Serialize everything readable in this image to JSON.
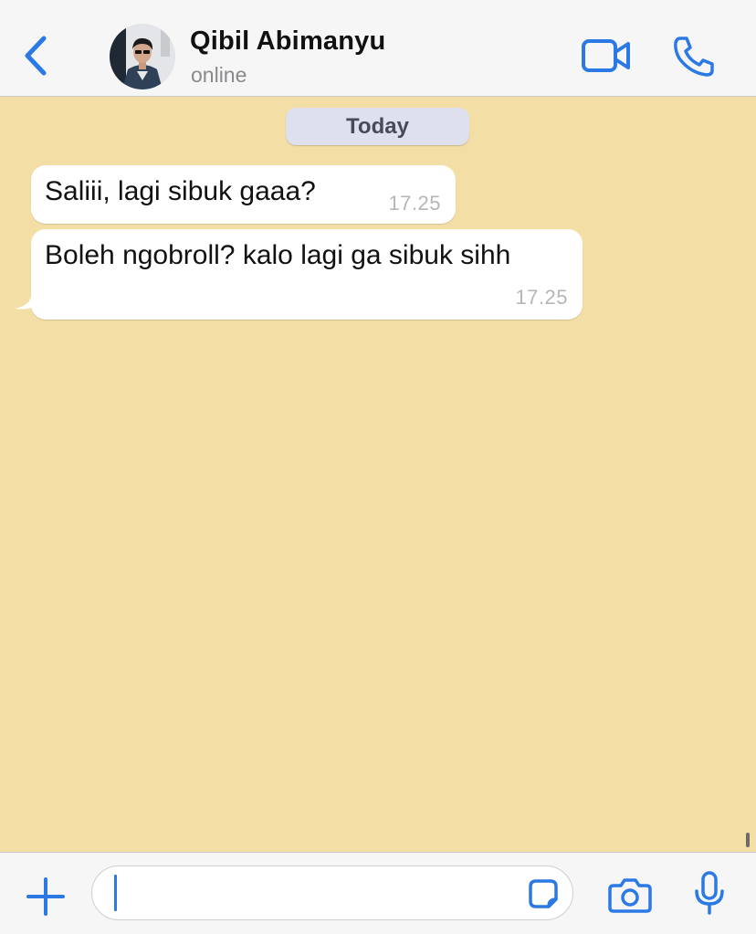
{
  "header": {
    "contact_name": "Qibil Abimanyu",
    "status": "online",
    "icons": [
      "chevron-left-icon",
      "video-camera-icon",
      "phone-icon"
    ]
  },
  "chat": {
    "date_label": "Today",
    "messages": [
      {
        "text": "Saliii, lagi sibuk gaaa?",
        "time": "17.25",
        "direction": "incoming"
      },
      {
        "text": "Boleh ngobroll? kalo lagi ga sibuk sihh",
        "time": "17.25",
        "direction": "incoming"
      }
    ]
  },
  "input_bar": {
    "message_value": "",
    "icons": [
      "plus-icon",
      "sticker-icon",
      "camera-icon",
      "microphone-icon"
    ]
  },
  "colors": {
    "accent": "#2b79e5",
    "chat_background": "#f3dfa5",
    "bubble": "#ffffff",
    "date_pill": "#dfe0ee",
    "timestamp": "#b6b6b6"
  }
}
